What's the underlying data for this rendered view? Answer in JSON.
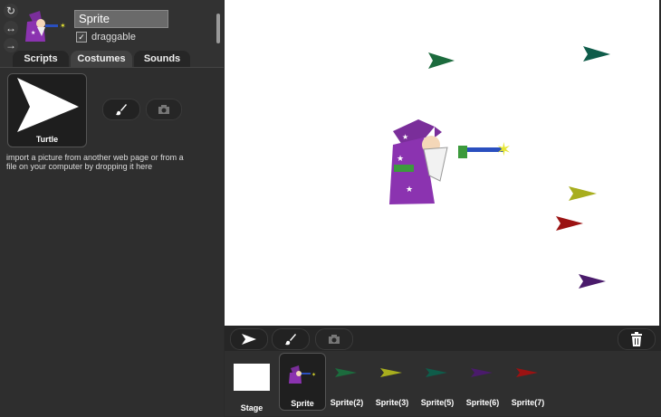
{
  "sprite": {
    "name": "Sprite",
    "draggable_label": "draggable",
    "draggable_checked": "✓"
  },
  "tabs": [
    {
      "label": "Scripts"
    },
    {
      "label": "Costumes"
    },
    {
      "label": "Sounds"
    }
  ],
  "costume": {
    "label": "Turtle"
  },
  "import_hint": "import a picture from another web page or from a file on your computer by dropping it here",
  "stage_label": "Stage",
  "sprites": [
    {
      "label": "Sprite",
      "color": "#7a2e9a"
    },
    {
      "label": "Sprite(2)",
      "color": "#1c6b3d"
    },
    {
      "label": "Sprite(3)",
      "color": "#a8ae1e"
    },
    {
      "label": "Sprite(5)",
      "color": "#0f5c4a"
    },
    {
      "label": "Sprite(6)",
      "color": "#4a1b6b"
    },
    {
      "label": "Sprite(7)",
      "color": "#9b1212"
    }
  ]
}
